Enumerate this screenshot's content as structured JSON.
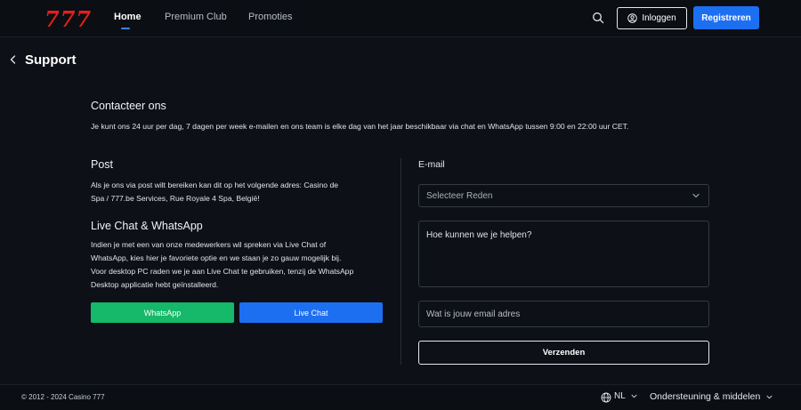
{
  "header": {
    "logo": "777",
    "nav": [
      {
        "label": "Home"
      },
      {
        "label": "Premium Club"
      },
      {
        "label": "Promoties"
      }
    ],
    "login_label": "Inloggen",
    "register_label": "Registreren"
  },
  "page": {
    "title": "Support"
  },
  "contact": {
    "title": "Contacteer ons",
    "text": "Je kunt ons 24 uur per dag, 7 dagen per week e-mailen en ons team is elke dag van het jaar beschikbaar via chat en WhatsApp tussen 9:00 en 22:00 uur CET."
  },
  "post": {
    "title": "Post",
    "line1": "Als je ons via post wilt bereiken kan dit op het volgende adres: Casino de",
    "line2": "Spa / 777.be Services, Rue Royale 4 Spa, België!"
  },
  "livechat": {
    "title": "Live Chat & WhatsApp",
    "line1": "Indien je met een van onze medewerkers wil spreken via Live Chat of",
    "line2": "WhatsApp, kies hier je favoriete optie en we staan je zo gauw mogelijk bij.",
    "line3": "Voor desktop PC raden we je aan Live Chat te gebruiken, tenzij de WhatsApp",
    "line4": "Desktop applicatie hebt geïnstalleerd.",
    "whatsapp_label": "WhatsApp",
    "livechat_label": "Live Chat"
  },
  "email_form": {
    "label": "E-mail",
    "reason_placeholder": "Selecteer Reden",
    "message_placeholder": "Hoe kunnen we je helpen?",
    "email_placeholder": "Wat is jouw email adres",
    "submit_label": "Verzenden"
  },
  "footer": {
    "copyright": "© 2012 - 2024 Casino 777",
    "language": "NL",
    "support_menu": "Ondersteuning & middelen"
  },
  "colors": {
    "background": "#0d1016",
    "accent_blue": "#1d6ff2",
    "whatsapp_green": "#16b86a",
    "logo_red": "#e0201c"
  }
}
